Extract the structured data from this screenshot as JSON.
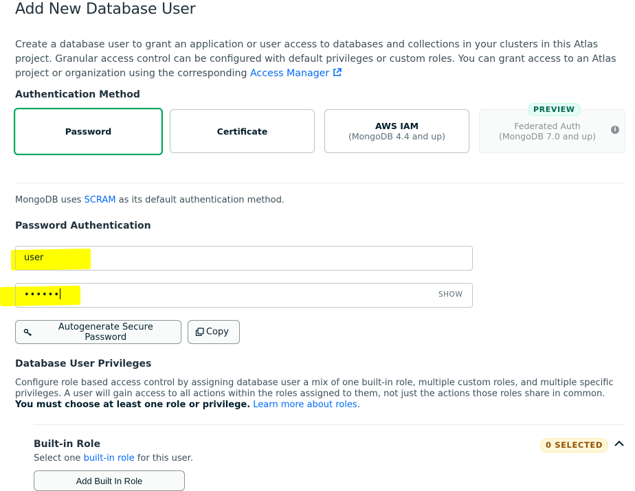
{
  "page": {
    "title": "Add New Database User"
  },
  "intro": {
    "text_before_link": "Create a database user to grant an application or user access to databases and collections in your clusters in this Atlas project. Granular access control can be configured with default privileges or custom roles. You can grant access to an Atlas project or organization using the corresponding ",
    "link_label": "Access Manager"
  },
  "auth": {
    "heading": "Authentication Method",
    "options": [
      {
        "label": "Password",
        "sub": ""
      },
      {
        "label": "Certificate",
        "sub": ""
      },
      {
        "label": "AWS IAM",
        "sub": "(MongoDB 4.4 and up)"
      },
      {
        "label": "Federated Auth",
        "sub": "(MongoDB 7.0 and up)",
        "badge": "PREVIEW"
      }
    ],
    "selected": "Password",
    "note_before": "MongoDB uses ",
    "note_link": "SCRAM",
    "note_after": " as its default authentication method."
  },
  "password_auth": {
    "heading": "Password Authentication",
    "username_value": "user",
    "password_value": "••••••",
    "show_label": "SHOW",
    "autogenerate_label": "Autogenerate Secure Password",
    "copy_label": "Copy"
  },
  "privileges": {
    "heading": "Database User Privileges",
    "text_before_bold": "Configure role based access control by assigning database user a mix of one built-in role, multiple custom roles, and multiple specific privileges. A user will gain access to all actions within the roles assigned to them, not just the actions those roles share in common. ",
    "bold_text": "You must choose at least one role or privilege.",
    "link_label": "Learn more about roles."
  },
  "builtin_role": {
    "heading": "Built-in Role",
    "desc_before": "Select one ",
    "desc_link": "built-in role",
    "desc_after": " for this user.",
    "selected_badge": "0 SELECTED",
    "add_button": "Add Built In Role"
  },
  "colors": {
    "accent_green": "#00a35c",
    "link_blue": "#016bf8",
    "highlight": "#ffff00",
    "badge_yellow": "#fef7db"
  }
}
